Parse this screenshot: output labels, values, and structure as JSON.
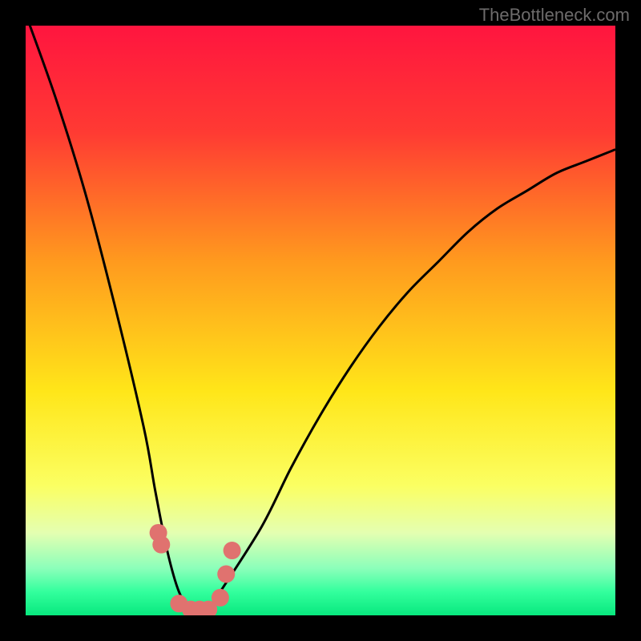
{
  "watermark": "TheBottleneck.com",
  "chart_data": {
    "type": "line",
    "title": "",
    "xlabel": "",
    "ylabel": "",
    "xlim": [
      0,
      100
    ],
    "ylim": [
      0,
      100
    ],
    "series": [
      {
        "name": "bottleneck-curve",
        "x": [
          0,
          5,
          10,
          15,
          20,
          22,
          24,
          26,
          28,
          30,
          31,
          33,
          40,
          45,
          50,
          55,
          60,
          65,
          70,
          75,
          80,
          85,
          90,
          95,
          100
        ],
        "y": [
          102,
          88,
          72,
          53,
          32,
          21,
          11,
          4,
          1,
          0.5,
          1,
          4,
          15,
          25,
          34,
          42,
          49,
          55,
          60,
          65,
          69,
          72,
          75,
          77,
          79
        ]
      }
    ],
    "highlight_points": {
      "name": "marker-points",
      "x": [
        22.5,
        23,
        26,
        28,
        29.5,
        31,
        33,
        34,
        35
      ],
      "y": [
        14,
        12,
        2,
        1,
        1,
        1,
        3,
        7,
        11
      ]
    },
    "gradient_stops": [
      {
        "offset": 0,
        "color": "#ff153f"
      },
      {
        "offset": 0.18,
        "color": "#ff3a33"
      },
      {
        "offset": 0.4,
        "color": "#ff9a1e"
      },
      {
        "offset": 0.62,
        "color": "#ffe619"
      },
      {
        "offset": 0.78,
        "color": "#fbff62"
      },
      {
        "offset": 0.86,
        "color": "#e4ffb1"
      },
      {
        "offset": 0.92,
        "color": "#8cffba"
      },
      {
        "offset": 0.96,
        "color": "#33ff9d"
      },
      {
        "offset": 1.0,
        "color": "#08e87e"
      }
    ],
    "marker_color": "#e0726f",
    "curve_color": "#000000"
  }
}
